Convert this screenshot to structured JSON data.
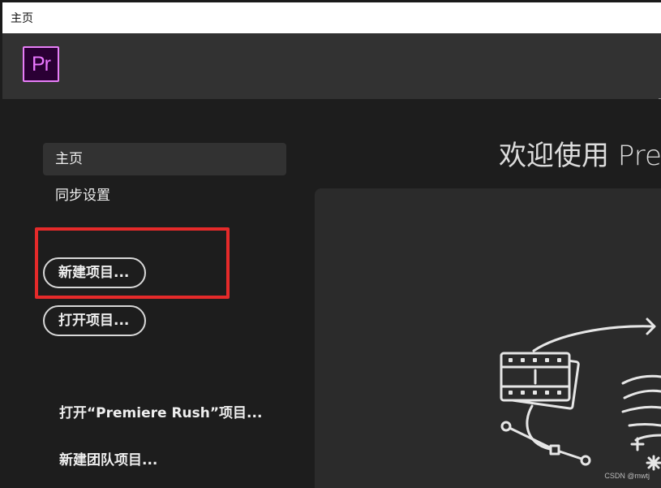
{
  "window": {
    "title": "主页"
  },
  "app": {
    "logo_text": "Pr",
    "logo_accent": "#ea77ff"
  },
  "sidebar": {
    "items": [
      {
        "label": "主页",
        "active": true
      },
      {
        "label": "同步设置",
        "active": false
      }
    ],
    "buttons": {
      "new_project": "新建项目...",
      "open_project": "打开项目..."
    },
    "links": {
      "open_rush": "打开“Premiere Rush”项目...",
      "new_team": "新建团队项目..."
    }
  },
  "main": {
    "welcome": "欢迎使用 Pre"
  },
  "annotation": {
    "highlight_color": "#e52a2a"
  },
  "watermark": "CSDN @mwtj"
}
